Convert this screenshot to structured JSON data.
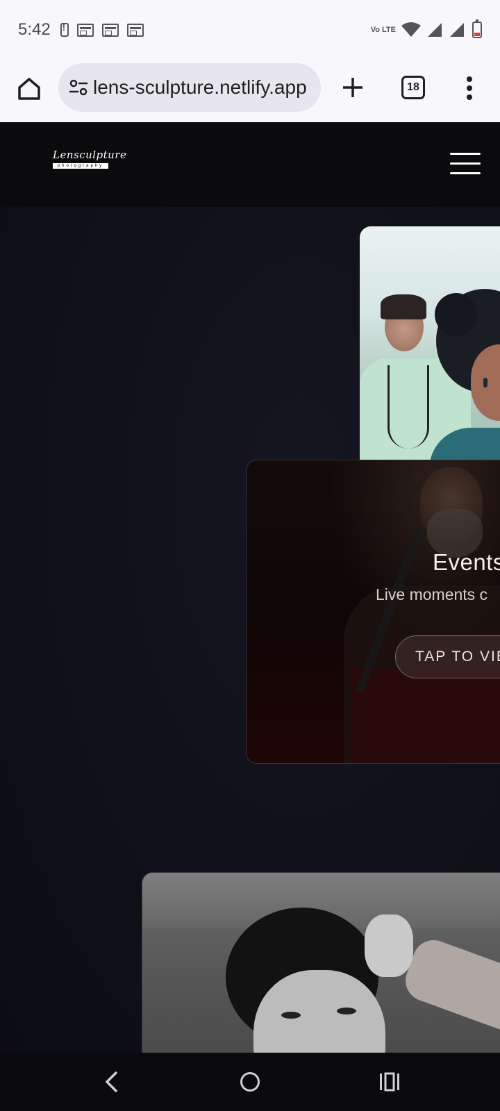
{
  "status_bar": {
    "time": "5:42",
    "volte_label": "Vo LTE",
    "icons": [
      "battery-alert-icon",
      "news-icon",
      "news-icon",
      "news-icon",
      "volte-icon",
      "wifi-icon",
      "signal-icon",
      "signal-icon",
      "battery-low-icon"
    ]
  },
  "browser": {
    "url": "lens-sculpture.netlify.app",
    "tab_count": "18",
    "icons": [
      "home-icon",
      "site-settings-icon",
      "new-tab-icon",
      "tab-switcher-icon",
      "more-menu-icon"
    ]
  },
  "site": {
    "logo": {
      "name": "Lensculpture",
      "tagline": "photography"
    },
    "events_card": {
      "title": "Events",
      "subtitle": "Live moments c",
      "button_label": "TAP TO VIE"
    }
  },
  "nav_bar": {
    "icons": [
      "back-icon",
      "home-icon",
      "recents-icon"
    ]
  },
  "colors": {
    "status_bg": "#f8f7fc",
    "url_pill_bg": "#e7e6ec",
    "site_header_bg": "#0b0b0d",
    "site_bg": "#0f1019",
    "accent_white": "#ffffff"
  }
}
